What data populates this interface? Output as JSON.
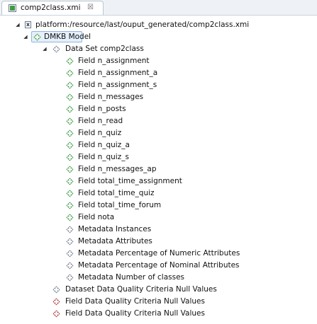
{
  "editor": {
    "tab_title": "comp2class.xmi",
    "tab_close": "☒"
  },
  "tree": {
    "resource": "platform:/resource/last/ouput_generated/comp2class.xmi",
    "model": "DMKB Model",
    "dataset": "Data Set comp2class",
    "fields": [
      "Field n_assignment",
      "Field n_assignment_a",
      "Field n_assignment_s",
      "Field n_messages",
      "Field n_posts",
      "Field n_read",
      "Field n_quiz",
      "Field n_quiz_a",
      "Field n_quiz_s",
      "Field n_messages_ap",
      "Field total_time_assignment",
      "Field total_time_quiz",
      "Field total_time_forum",
      "Field nota"
    ],
    "metadata": [
      "Metadata Instances",
      "Metadata Attributes",
      "Metadata Percentage of Numeric Attributes",
      "Metadata Percentage of Nominal Attributes",
      "Metadata Number of classes"
    ],
    "criteria": [
      "Dataset Data Quality Criteria Null Values",
      "Field Data Quality Criteria Null Values",
      "Field Data Quality Criteria Null Values"
    ]
  },
  "icons": {
    "field": "green-diamond-icon",
    "metadata": "gray-diamond-icon",
    "dataset_criteria": "gray-diamond-icon",
    "field_criteria": "red-diamond-icon"
  },
  "colors": {
    "selection_bg": "#e5f0fb",
    "selection_border": "#8fb5df",
    "field_icon": "#3f9b45",
    "gray_icon": "#7b8490",
    "red_icon": "#b24040"
  }
}
